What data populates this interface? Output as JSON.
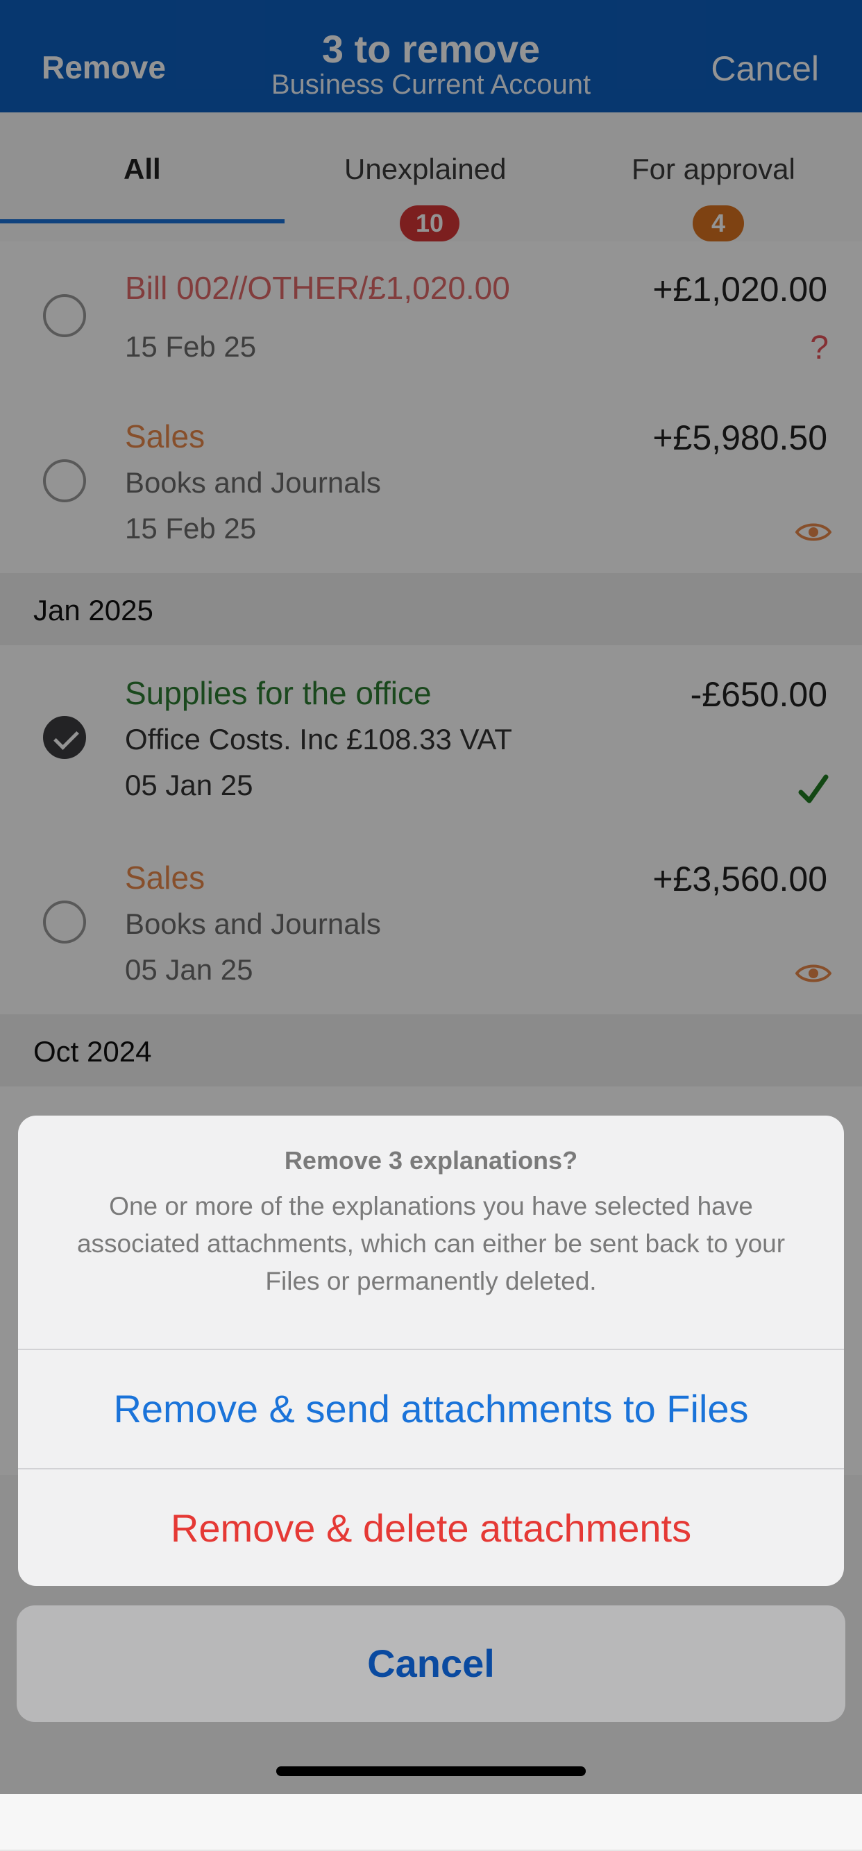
{
  "header": {
    "left_action": "Remove",
    "title": "3 to remove",
    "subtitle": "Business Current Account",
    "right_action": "Cancel"
  },
  "tabs": [
    {
      "label": "All",
      "active": true
    },
    {
      "label": "Unexplained",
      "badge": "10"
    },
    {
      "label": "For approval",
      "badge": "4"
    }
  ],
  "rows": [
    {
      "title": "Bill 002//OTHER/£1,020.00",
      "date": "15 Feb 25",
      "amount": "+£1,020.00",
      "status": "?"
    },
    {
      "title": "Sales",
      "category": "Books and Journals",
      "date": "15 Feb 25",
      "amount": "+£5,980.50"
    },
    {
      "title": "Supplies for the office",
      "category": "Office Costs. Inc £108.33 VAT",
      "date": "05 Jan 25",
      "amount": "-£650.00"
    },
    {
      "title": "Sales",
      "category": "Books and Journals",
      "date": "05 Jan 25",
      "amount": "+£3,560.00"
    }
  ],
  "sections": [
    "Jan 2025",
    "Oct 2024"
  ],
  "colors": {
    "header_bg": "#0d5fbf",
    "bill_title": "#e06a6a",
    "sales_title": "#e8894a",
    "supplies_title": "#2e7d32",
    "badge_red": "#d63636",
    "badge_orange": "#d9731f",
    "action_blue": "#1a73d9",
    "action_red": "#e53935"
  },
  "sheet": {
    "title": "Remove 3 explanations?",
    "message": "One or more of the explanations you have selected have associated attachments, which can either be sent back to your Files or permanently deleted.",
    "send_label": "Remove & send attachments to Files",
    "delete_label": "Remove & delete attachments",
    "cancel_label": "Cancel"
  }
}
